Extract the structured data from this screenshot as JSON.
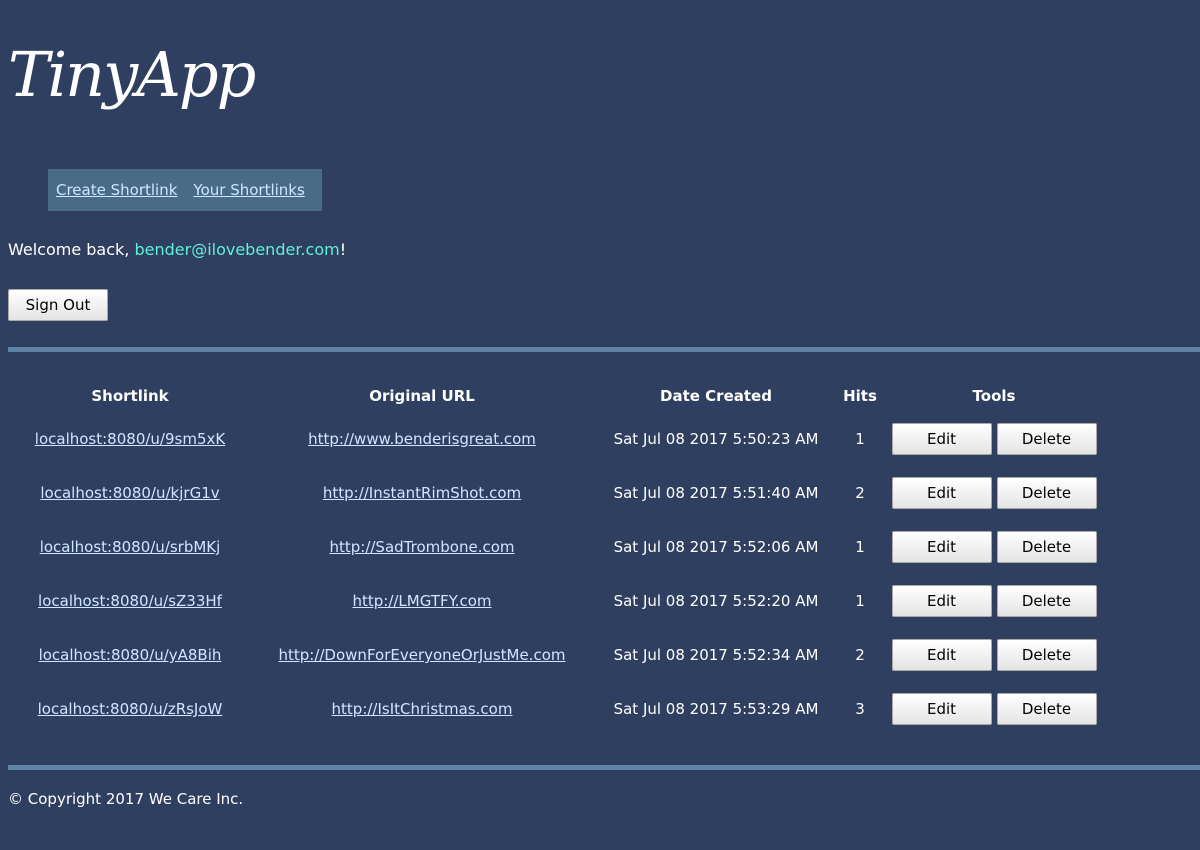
{
  "app": {
    "logo_text": "TinyApp"
  },
  "nav": {
    "create_label": "Create Shortlink",
    "list_label": "Your Shortlinks"
  },
  "welcome": {
    "prefix": "Welcome back, ",
    "email": "bender@ilovebender.com",
    "suffix": "!"
  },
  "sign_out_label": "Sign Out",
  "table": {
    "headers": [
      "Shortlink",
      "Original URL",
      "Date Created",
      "Hits",
      "Tools"
    ],
    "edit_label": "Edit",
    "delete_label": "Delete",
    "rows": [
      {
        "short": "localhost:8080/u/9sm5xK",
        "url": "http://www.benderisgreat.com",
        "date": "Sat Jul 08 2017 5:50:23 AM",
        "hits": "1"
      },
      {
        "short": "localhost:8080/u/kjrG1v",
        "url": "http://InstantRimShot.com",
        "date": "Sat Jul 08 2017 5:51:40 AM",
        "hits": "2"
      },
      {
        "short": "localhost:8080/u/srbMKj",
        "url": "http://SadTrombone.com",
        "date": "Sat Jul 08 2017 5:52:06 AM",
        "hits": "1"
      },
      {
        "short": "localhost:8080/u/sZ33Hf",
        "url": "http://LMGTFY.com",
        "date": "Sat Jul 08 2017 5:52:20 AM",
        "hits": "1"
      },
      {
        "short": "localhost:8080/u/yA8Bih",
        "url": "http://DownForEveryoneOrJustMe.com",
        "date": "Sat Jul 08 2017 5:52:34 AM",
        "hits": "2"
      },
      {
        "short": "localhost:8080/u/zRsJoW",
        "url": "http://IsItChristmas.com",
        "date": "Sat Jul 08 2017 5:53:29 AM",
        "hits": "3"
      }
    ]
  },
  "footer": {
    "text": "© Copyright 2017 We Care Inc."
  },
  "colors": {
    "background": "#2f3f60",
    "nav_background": "#4a6b85",
    "rule": "#5f83a4",
    "link": "#cfe6ff",
    "email": "#5ff0d8"
  }
}
